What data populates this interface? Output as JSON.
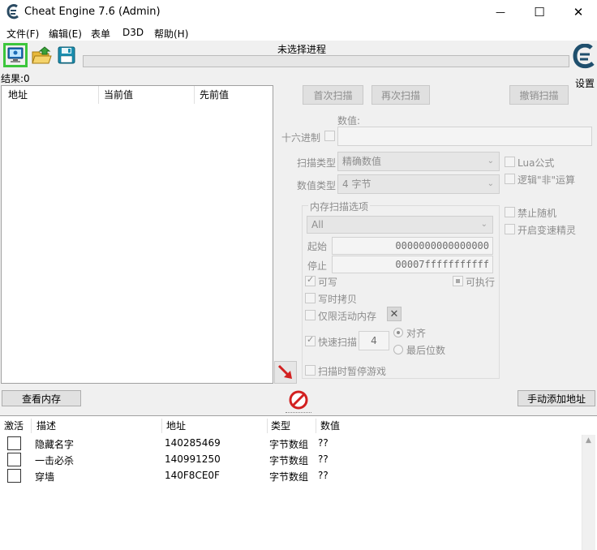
{
  "window": {
    "title": "Cheat Engine 7.6 (Admin)",
    "minimize": "—",
    "maximize": "☐",
    "close": "✕"
  },
  "menu": [
    "文件(F)",
    "编辑(E)",
    "表单",
    "D3D",
    "帮助(H)"
  ],
  "toolbar": {
    "process_status": "未选择进程",
    "settings_label": "设置"
  },
  "results_label": "结果:0",
  "found_list": {
    "columns": [
      "地址",
      "当前值",
      "先前值"
    ]
  },
  "scan": {
    "first_scan": "首次扫描",
    "next_scan": "再次扫描",
    "undo_scan": "撤销扫描",
    "value_label": "数值:",
    "hex_label": "十六进制",
    "scan_type_label": "扫描类型",
    "scan_type_value": "精确数值",
    "value_type_label": "数值类型",
    "value_type_value": "4 字节",
    "lua_formula": "Lua公式",
    "logic_not": "逻辑\"非\"运算",
    "disable_random": "禁止随机",
    "speedhack": "开启变速精灵"
  },
  "memory_options": {
    "title": "内存扫描选项",
    "region": "All",
    "start_label": "起始",
    "start_value": "0000000000000000",
    "stop_label": "停止",
    "stop_value": "00007fffffffffff",
    "writable": "可写",
    "executable": "可执行",
    "copy_on_write": "写时拷贝",
    "active_memory_only": "仅限活动内存",
    "fast_scan": "快速扫描",
    "fast_scan_value": "4",
    "aligned": "对齐",
    "last_digits": "最后位数",
    "pause_game": "扫描时暂停游戏"
  },
  "buttons": {
    "view_memory": "查看内存",
    "add_address": "手动添加地址"
  },
  "address_table": {
    "columns": [
      "激活",
      "描述",
      "地址",
      "类型",
      "数值"
    ],
    "rows": [
      {
        "desc": "隐藏名字",
        "addr": "140285469",
        "type": "字节数组",
        "value": "??"
      },
      {
        "desc": "一击必杀",
        "addr": "140991250",
        "type": "字节数组",
        "value": "??"
      },
      {
        "desc": "穿墙",
        "addr": "140F8CE0F",
        "type": "字节数组",
        "value": "??"
      }
    ]
  },
  "colors": {
    "selected_toolbar_border": "#3cc63c",
    "arrow_red": "#d22020"
  }
}
